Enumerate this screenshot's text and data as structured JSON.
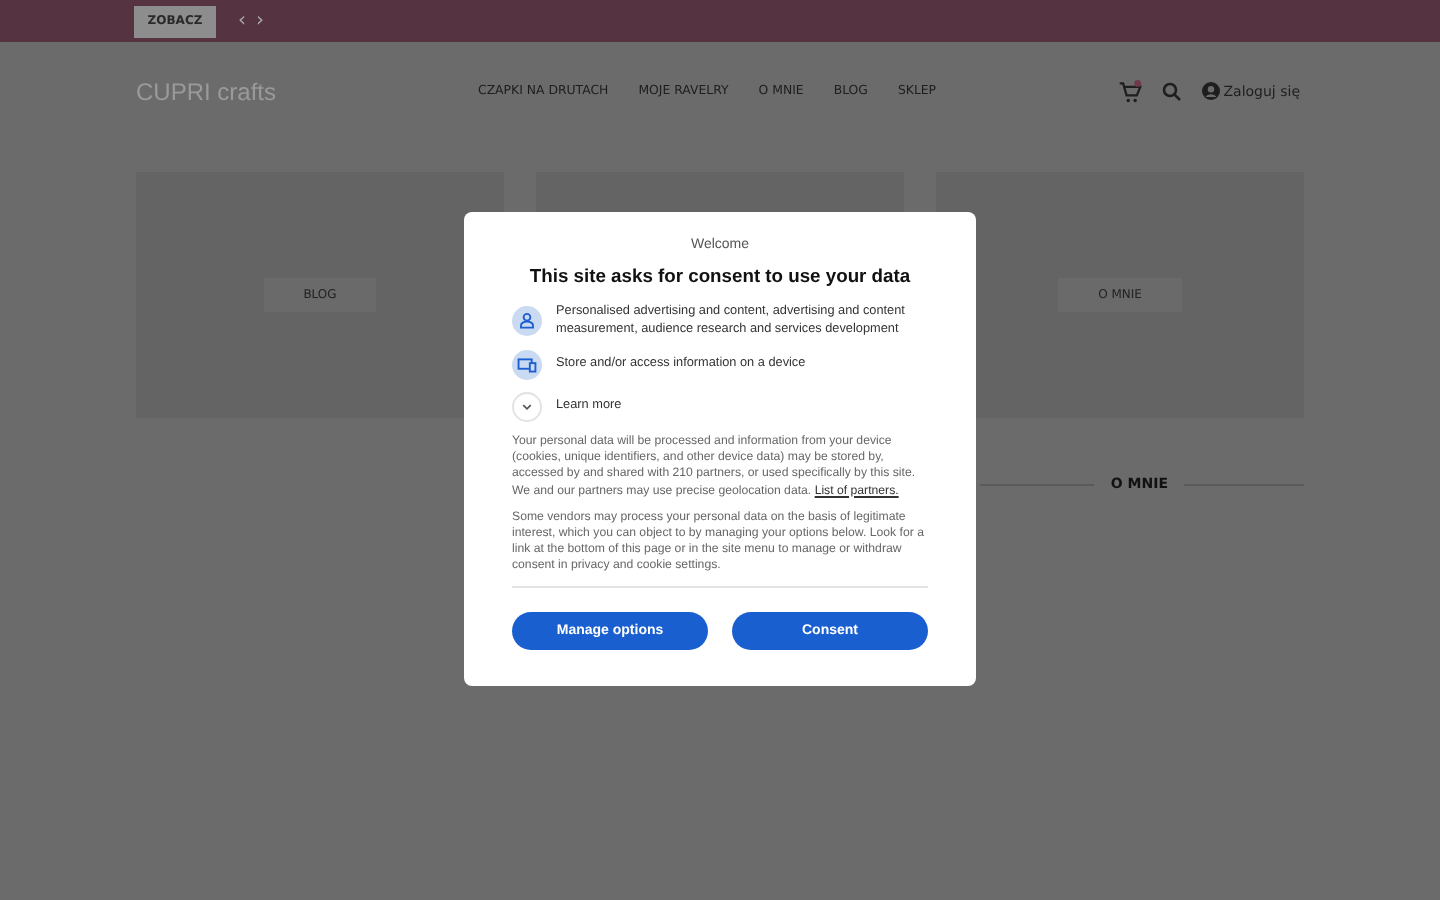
{
  "top_bar": {
    "button": "ZOBACZ",
    "prev": "‹",
    "next": "›"
  },
  "header": {
    "logo": "CUPRI crafts",
    "nav": [
      "CZAPKI NA DRUTACH",
      "MOJE RAVELRY",
      "O MNIE",
      "BLOG",
      "SKLEP"
    ],
    "login": "Zaloguj się"
  },
  "cards": [
    {
      "kind": "post",
      "label": "BLOG"
    },
    {
      "kind": "post"
    },
    {
      "kind": "post",
      "label": "O MNIE"
    }
  ],
  "section_heading": "O MNIE",
  "consent_dialog": {
    "welcome": "Welcome",
    "title": "This site asks for consent to use your data",
    "purposes": [
      {
        "kind": "person",
        "text": "Personalised advertising and content, advertising and content measurement, audience research and services development"
      },
      {
        "kind": "device",
        "text": "Store and/or access information on a device"
      }
    ],
    "learn_more": "Learn more",
    "paragraph_1": "Your personal data will be processed and information from your device (cookies, unique identifiers, and other device data) may be stored by, accessed by and shared with 210 partners, or used specifically by this site. We and our partners may use precise geolocation data.",
    "partners_link": "List of partners.",
    "paragraph_2": "Some vendors may process your personal data on the basis of legitimate interest, which you can object to by managing your options below. Look for a link at the bottom of this page or in the site menu to manage or withdraw consent in privacy and cookie settings.",
    "buttons": [
      "Manage options",
      "Consent"
    ]
  }
}
